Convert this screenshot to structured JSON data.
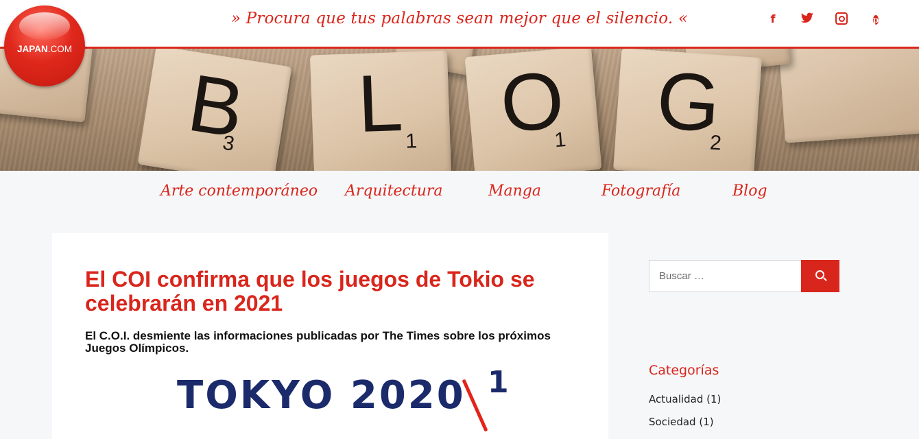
{
  "header": {
    "tagline": "» Procura que tus palabras sean mejor que el silencio. «",
    "logo": {
      "text_main": "JAPAN",
      "text_suffix": ".COM"
    },
    "social": [
      {
        "name": "facebook-icon",
        "glyph": "f"
      },
      {
        "name": "twitter-icon",
        "glyph": ""
      },
      {
        "name": "instagram-icon",
        "glyph": ""
      },
      {
        "name": "pinterest-icon",
        "glyph": "p"
      }
    ]
  },
  "hero": {
    "tiles": [
      {
        "letter": "B",
        "score": "3"
      },
      {
        "letter": "L",
        "score": "1"
      },
      {
        "letter": "O",
        "score": "1"
      },
      {
        "letter": "G",
        "score": "2"
      }
    ]
  },
  "nav": {
    "items": [
      "Arte contemporáneo",
      "Arquitectura",
      "Manga",
      "Fotografía",
      "Blog"
    ]
  },
  "article": {
    "title": "El COI confirma que los juegos de Tokio se celebrarán en 2021",
    "subtitle": "El C.O.I. desmiente las informaciones publicadas por The Times sobre los próximos Juegos Olímpicos.",
    "image": {
      "text": "TOKYO 2020",
      "overlay_digit": "1"
    }
  },
  "sidebar": {
    "search": {
      "placeholder": "Buscar …"
    },
    "categories_title": "Categorías",
    "categories": [
      {
        "label": "Actualidad (1)"
      },
      {
        "label": "Sociedad (1)"
      }
    ]
  },
  "colors": {
    "accent": "#d9261c",
    "tokyo_blue": "#1b2a6b",
    "background": "#f6f7f9"
  }
}
